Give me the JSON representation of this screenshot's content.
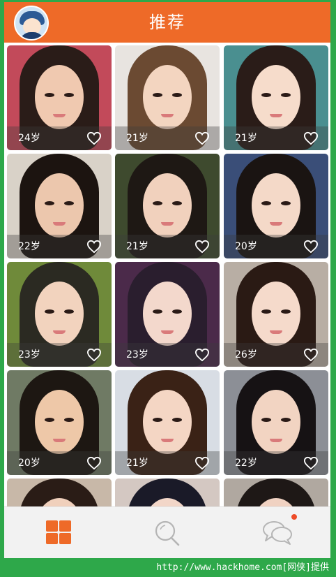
{
  "header": {
    "title": "推荐",
    "avatar_icon": "user-avatar-icon",
    "color": "#ee6a28"
  },
  "profiles": [
    {
      "age": "24岁",
      "hair": "#2a1c18",
      "bg": "#c24a5a",
      "skin": "#f0c9b0"
    },
    {
      "age": "21岁",
      "hair": "#6b4a32",
      "bg": "#e8e4e0",
      "skin": "#f3d5c0"
    },
    {
      "age": "21岁",
      "hair": "#2a1c18",
      "bg": "#4a8f90",
      "skin": "#f6dccb"
    },
    {
      "age": "22岁",
      "hair": "#1c1410",
      "bg": "#d9d2c8",
      "skin": "#ecc7ad"
    },
    {
      "age": "21岁",
      "hair": "#1e1814",
      "bg": "#3e4a2e",
      "skin": "#f1d1bd"
    },
    {
      "age": "20岁",
      "hair": "#1a1412",
      "bg": "#3a4e78",
      "skin": "#f4d9c8"
    },
    {
      "age": "23岁",
      "hair": "#2b2a22",
      "bg": "#6f8a3a",
      "skin": "#f2d3be"
    },
    {
      "age": "23岁",
      "hair": "#2a1e2e",
      "bg": "#4b2a4a",
      "skin": "#f3d8cc"
    },
    {
      "age": "26岁",
      "hair": "#2a1a14",
      "bg": "#b8aea4",
      "skin": "#f5dacb"
    },
    {
      "age": "20岁",
      "hair": "#1d1712",
      "bg": "#6f7a64",
      "skin": "#eec8a8"
    },
    {
      "age": "21岁",
      "hair": "#3a2216",
      "bg": "#d8dde4",
      "skin": "#f4d6c4"
    },
    {
      "age": "22岁",
      "hair": "#161214",
      "bg": "#8c8f96",
      "skin": "#f2d4c2"
    },
    {
      "age": "",
      "hair": "#2a1c16",
      "bg": "#c8b8a8",
      "skin": "#f0d0bc"
    },
    {
      "age": "",
      "hair": "#1a1a28",
      "bg": "#d4c8c2",
      "skin": "#f2d6c8"
    },
    {
      "age": "",
      "hair": "#1e1816",
      "bg": "#b0a8a0",
      "skin": "#f0d2c2"
    }
  ],
  "heart_icon": "heart-outline-icon",
  "tabbar": {
    "tabs": [
      {
        "icon": "grid-icon",
        "active": true
      },
      {
        "icon": "search-icon",
        "active": false
      },
      {
        "icon": "chat-bubbles-icon",
        "active": false,
        "badge": true
      }
    ],
    "active_color": "#ee6a28",
    "inactive_color": "#b5b5b5"
  },
  "footer": {
    "text": "http://www.hackhome.com[网侠]提供"
  }
}
